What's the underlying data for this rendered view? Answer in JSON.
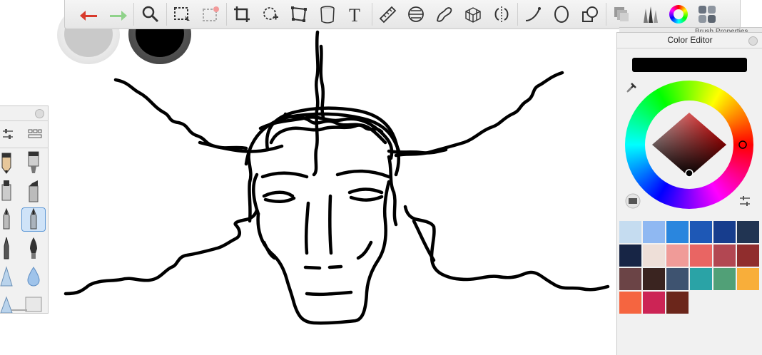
{
  "color_editor": {
    "title": "Color Editor",
    "brush_properties_label": "Brush Properties",
    "current_color": "#000000",
    "swatches": [
      "#c5dcf0",
      "#8fb8f2",
      "#2a86de",
      "#1e58b6",
      "#173d8d",
      "#213452",
      "#172545",
      "#eedfd8",
      "#f09b98",
      "#e96563",
      "#b24752",
      "#902d2d",
      "#6b4446",
      "#3a2420",
      "#3e5370",
      "#2aa3a6",
      "#51a077",
      "#f8ae3a",
      "#f56540",
      "#cc2455",
      "#6b261b"
    ]
  },
  "toolbar": {
    "tools": [
      "undo-icon",
      "redo-icon",
      "zoom-icon",
      "rect-select-icon",
      "rect-select-clear-icon",
      "crop-icon",
      "lasso-transform-icon",
      "distort-icon",
      "bucket-icon",
      "text-icon",
      "ruler-icon",
      "ellipse-guide-icon",
      "french-curve-icon",
      "perspective-icon",
      "symmetry-icon",
      "stroke-icon",
      "ellipse-icon",
      "shapes-icon",
      "layers-icon",
      "brush-library-icon",
      "color-wheel-icon",
      "palette-icon"
    ]
  },
  "brush_palette": {
    "tools": [
      "pencil-icon",
      "marker-icon",
      "airbrush-icon",
      "chisel-marker-icon",
      "ballpoint-icon",
      "fine-pen-icon",
      "ink-pen-icon",
      "fountain-pen-icon",
      "cone-brush-icon",
      "water-drop-icon",
      "soft-cone-icon",
      "eraser-icon"
    ]
  },
  "brush_pucks": {
    "size_color": "#c9c9c9",
    "opacity_color": "#000000"
  }
}
